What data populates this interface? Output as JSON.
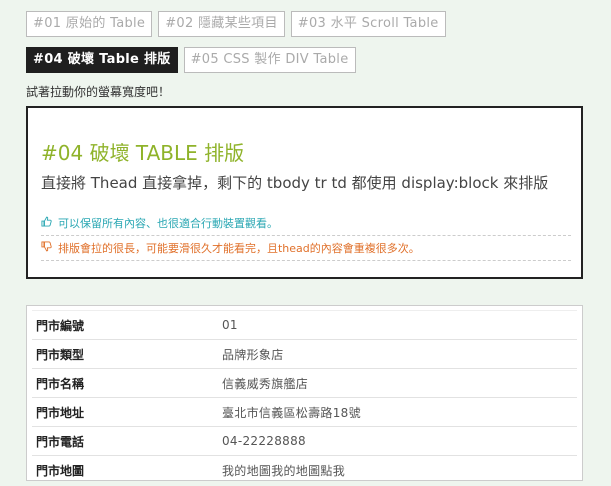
{
  "tabs_row1": [
    {
      "label": "#01 原始的 Table"
    },
    {
      "label": "#02 隱藏某些項目"
    },
    {
      "label": "#03 水平 Scroll Table"
    }
  ],
  "tabs_row2": [
    {
      "label": "#04 破壞 Table 排版",
      "active": true
    },
    {
      "label": "#05 CSS 製作 DIV Table"
    }
  ],
  "hint": "試著拉動你的螢幕寬度吧！",
  "info": {
    "title": "#04 破壞 TABLE 排版",
    "description": "直接將 Thead 直接拿掉，剩下的 tbody tr td 都使用 display:block 來排版",
    "pro": "可以保留所有內容、也很適合行動裝置觀看。",
    "con": "排版會拉的很長，可能要滑很久才能看完，且thead的內容會重複很多次。",
    "pro_color": "#2aa7b3",
    "con_color": "#e0702a",
    "title_color": "#8fb32a",
    "pro_icon": "thumbs-up-icon",
    "con_icon": "thumbs-down-icon"
  },
  "store": {
    "rows": [
      {
        "label": "門市編號",
        "value": "01"
      },
      {
        "label": "門市類型",
        "value": "品牌形象店"
      },
      {
        "label": "門市名稱",
        "value": "信義威秀旗艦店"
      },
      {
        "label": "門市地址",
        "value": "臺北市信義區松壽路18號"
      },
      {
        "label": "門市電話",
        "value": "04-22228888"
      },
      {
        "label": "門市地圖",
        "value": "我的地圖我的地圖點我"
      }
    ]
  }
}
